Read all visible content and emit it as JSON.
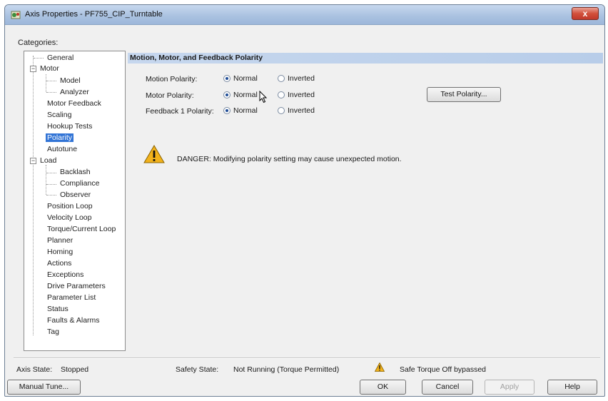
{
  "window": {
    "title": "Axis Properties - PF755_CIP_Turntable",
    "close_label": "x"
  },
  "categories": {
    "label": "Categories:",
    "items": [
      {
        "label": "General"
      },
      {
        "label": "Motor"
      },
      {
        "label": "Model"
      },
      {
        "label": "Analyzer"
      },
      {
        "label": "Motor Feedback"
      },
      {
        "label": "Scaling"
      },
      {
        "label": "Hookup Tests"
      },
      {
        "label": "Polarity"
      },
      {
        "label": "Autotune"
      },
      {
        "label": "Load"
      },
      {
        "label": "Backlash"
      },
      {
        "label": "Compliance"
      },
      {
        "label": "Observer"
      },
      {
        "label": "Position Loop"
      },
      {
        "label": "Velocity Loop"
      },
      {
        "label": "Torque/Current Loop"
      },
      {
        "label": "Planner"
      },
      {
        "label": "Homing"
      },
      {
        "label": "Actions"
      },
      {
        "label": "Exceptions"
      },
      {
        "label": "Drive Parameters"
      },
      {
        "label": "Parameter List"
      },
      {
        "label": "Status"
      },
      {
        "label": "Faults & Alarms"
      },
      {
        "label": "Tag"
      }
    ],
    "selected": "Polarity"
  },
  "panel": {
    "header": "Motion, Motor, and Feedback Polarity",
    "rows": [
      {
        "label": "Motion Polarity:",
        "normal": "Normal",
        "inverted": "Inverted",
        "selected": "Normal"
      },
      {
        "label": "Motor Polarity:",
        "normal": "Normal",
        "inverted": "Inverted",
        "selected": "Normal"
      },
      {
        "label": "Feedback 1 Polarity:",
        "normal": "Normal",
        "inverted": "Inverted",
        "selected": "Normal"
      }
    ],
    "test_button": "Test Polarity...",
    "danger_text": "DANGER: Modifying polarity setting may cause unexpected motion.",
    "warning_color": "#f2b21b"
  },
  "status": {
    "axis_state_label": "Axis State:",
    "axis_state_value": "Stopped",
    "safety_state_label": "Safety State:",
    "safety_state_value": "Not Running (Torque Permitted)",
    "safe_torque_text": "Safe Torque Off bypassed"
  },
  "buttons": {
    "manual_tune": "Manual Tune...",
    "ok": "OK",
    "cancel": "Cancel",
    "apply": "Apply",
    "help": "Help"
  }
}
